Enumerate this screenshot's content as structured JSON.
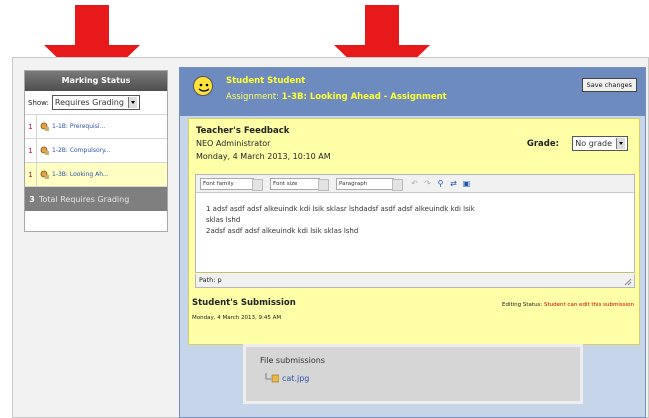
{
  "marking_panel": {
    "title": "Marking Status",
    "show_label": "Show:",
    "filter_value": "Requires Grading",
    "items": [
      {
        "count": "1",
        "label": "1-1B: Prerequisi..."
      },
      {
        "count": "1",
        "label": "1-2B: Compulsory..."
      },
      {
        "count": "1",
        "label": "1-3B: Looking Ah..."
      }
    ],
    "total": {
      "count": "3",
      "label": "Total Requires Grading"
    }
  },
  "grading_panel": {
    "student_name": "Student Student",
    "assignment_prefix": "Assignment:",
    "assignment_name": "1-3B: Looking Ahead - Assignment",
    "save_label": "Save changes",
    "feedback": {
      "title": "Teacher's Feedback",
      "author": "NEO Administrator",
      "date": "Monday, 4 March 2013, 10:10 AM",
      "grade_label": "Grade:",
      "grade_value": "No grade"
    },
    "editor": {
      "font_family": "Font family",
      "font_size": "Font size",
      "format": "Paragraph",
      "lines": [
        "1 adsf asdf adsf alkeuindk kdi lsik sklasr lshdadsf asdf adsf alkeuindk kdi lsik",
        "sklas lshd",
        "2adsf asdf adsf alkeuindk kdi lsik sklas lshd"
      ],
      "path": "Path: p"
    },
    "submission": {
      "title": "Student's Submission",
      "date": "Monday, 4 March 2013, 9:45 AM",
      "editing_label": "Editing Status:",
      "editing_value": "Student can edit this submission",
      "files_title": "File submissions",
      "file_name": "cat.jpg"
    }
  },
  "colors": {
    "arrow": "#e8191b",
    "header_blue": "#6e8bbf",
    "feedback_yellow": "#ffffa8",
    "link_blue": "#2a52a8"
  }
}
